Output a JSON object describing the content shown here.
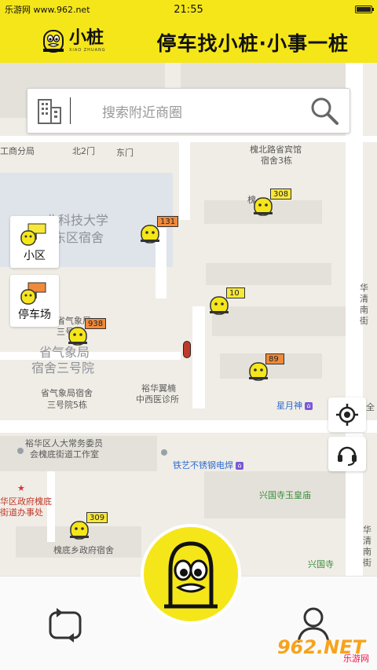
{
  "status_bar": {
    "carrier": "乐游网 www.962.net",
    "time": "21:55",
    "battery_level": 1.0
  },
  "header": {
    "logo_name": "小桩",
    "logo_sub": "XIAO ZHUANG",
    "slogan": "停车找小桩·小事一桩"
  },
  "search": {
    "placeholder": "搜索附近商圈"
  },
  "side_buttons": {
    "community": "小区",
    "parking_lot": "停车场"
  },
  "map_labels": {
    "l1": "工商分局",
    "l2": "北2门",
    "l3": "东门",
    "l4": "槐北路省宾馆",
    "l5": "宿舍3栋",
    "l6": "槐",
    "l7": "北科技大学",
    "l8": "东区宿舍",
    "l9": "省气象局",
    "l10": "三号院",
    "l11": "省气象局",
    "l12": "宿舍三号院",
    "l13": "省气象局宿舍",
    "l14": "三号院5栋",
    "l15": "裕华翼楠",
    "l16": "中西医诊所",
    "l17": "星月神",
    "l18": "裕华区人大常务委员",
    "l19": "会槐底街道工作室",
    "l20": "铁艺不锈钢电焊",
    "l21": "华区政府槐底",
    "l22": "街道办事处",
    "l23": "兴国寺玉皇庙",
    "l24": "槐底乡政府宿舍",
    "l25": "兴国寺",
    "l26": "华",
    "l27": "清",
    "l28": "南",
    "l29": "街",
    "l30": "全"
  },
  "markers": [
    {
      "count": "131",
      "flag_color": "#f08a3a"
    },
    {
      "count": "308",
      "flag_color": "#f7e83a"
    },
    {
      "count": "10",
      "flag_color": "#f7e83a"
    },
    {
      "count": "938",
      "flag_color": "#f08a3a"
    },
    {
      "count": "89",
      "flag_color": "#f08a3a"
    },
    {
      "count": "309",
      "flag_color": "#f7e83a"
    }
  ],
  "watermark": {
    "main": "962.NET",
    "sub": "乐游网"
  },
  "colors": {
    "brand_yellow": "#f5e61a",
    "map_bg": "#f0ede6",
    "poi_blue": "#2d6bd1"
  }
}
